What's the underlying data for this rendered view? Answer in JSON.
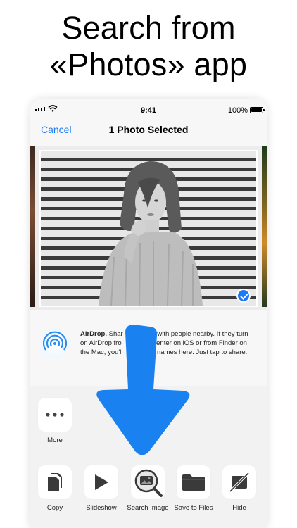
{
  "headline": {
    "line1": "Search from",
    "line2": "«Photos» app"
  },
  "status_bar": {
    "time": "9:41",
    "battery_percent": "100%"
  },
  "nav": {
    "cancel_label": "Cancel",
    "title": "1 Photo Selected"
  },
  "airdrop": {
    "title": "AirDrop.",
    "body_part1": " Shar",
    "body_part2": "with people nearby. If they turn on AirDrop fro",
    "body_part3": "Center on iOS or from Finder on the Mac, you'l",
    "body_part4": "names here. Just tap to share."
  },
  "actions_row1": [
    {
      "label": "More",
      "icon": "more-icon"
    }
  ],
  "actions_row2": [
    {
      "label": "Copy",
      "icon": "copy-icon"
    },
    {
      "label": "Slideshow",
      "icon": "play-icon"
    },
    {
      "label": "Search Image",
      "icon": "search-image-icon"
    },
    {
      "label": "Save to Files",
      "icon": "folder-icon"
    },
    {
      "label": "Hide",
      "icon": "hide-icon"
    }
  ],
  "colors": {
    "accent": "#1a7bf5",
    "arrow": "#1a82f0",
    "airdrop_ring": "#2a8cf0"
  }
}
